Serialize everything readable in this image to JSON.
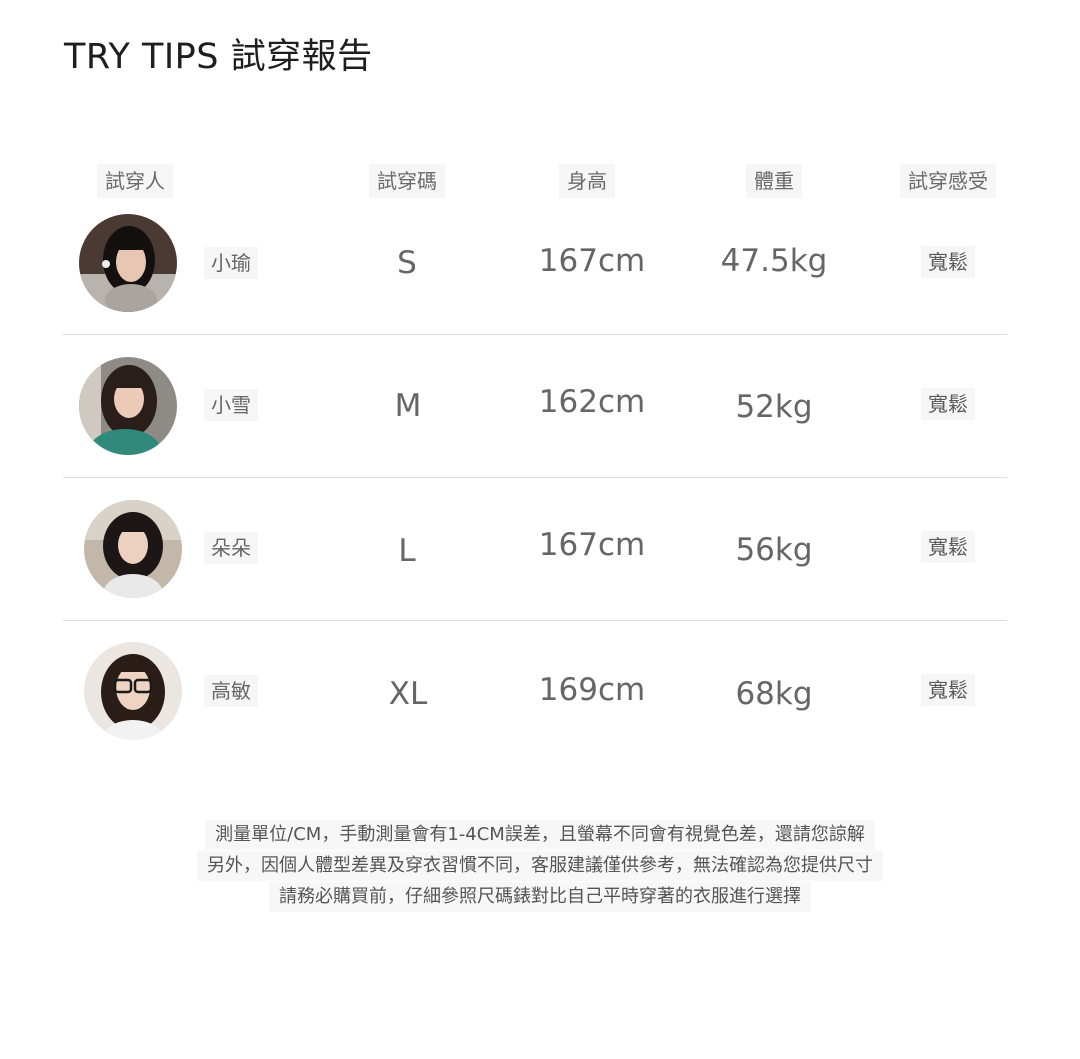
{
  "title": "TRY TIPS 試穿報告",
  "headers": {
    "person": "試穿人",
    "size": "試穿碼",
    "height": "身高",
    "weight": "體重",
    "feel": "試穿感受"
  },
  "rows": [
    {
      "name": "小瑜",
      "size": "S",
      "height": "167cm",
      "weight": "47.5kg",
      "feel": "寬鬆"
    },
    {
      "name": "小雪",
      "size": "M",
      "height": "162cm",
      "weight": "52kg",
      "feel": "寬鬆"
    },
    {
      "name": "朵朵",
      "size": "L",
      "height": "167cm",
      "weight": "56kg",
      "feel": "寬鬆"
    },
    {
      "name": "高敏",
      "size": "XL",
      "height": "169cm",
      "weight": "68kg",
      "feel": "寬鬆"
    }
  ],
  "notes": [
    "測量單位/CM，手動測量會有1-4CM誤差，且螢幕不同會有視覺色差，還請您諒解",
    "另外，因個人體型差異及穿衣習慣不同，客服建議僅供參考，無法確認為您提供尺寸",
    "請務必購買前，仔細參照尺碼錶對比自己平時穿著的衣服進行選擇"
  ]
}
